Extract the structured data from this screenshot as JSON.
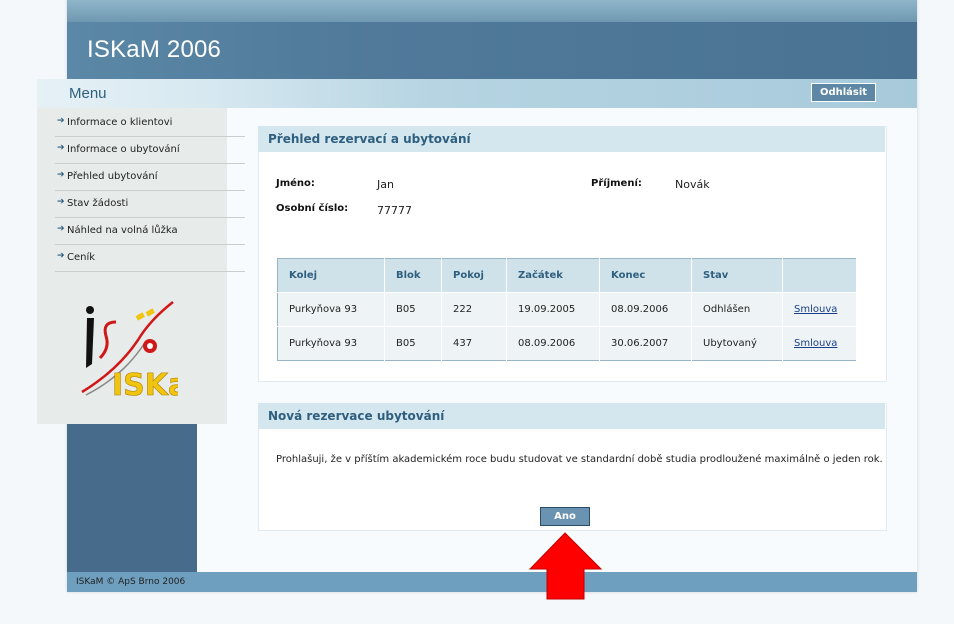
{
  "header": {
    "title": "ISKaM 2006",
    "menu_label": "Menu",
    "logout_label": "Odhlásit"
  },
  "sidebar": {
    "items": [
      {
        "label": "Informace o klientovi"
      },
      {
        "label": "Informace o ubytování"
      },
      {
        "label": "Přehled ubytování"
      },
      {
        "label": "Stav žádosti"
      },
      {
        "label": "Náhled na volná lůžka"
      },
      {
        "label": "Ceník"
      }
    ],
    "logo_text": "ISKaM"
  },
  "overview": {
    "title": "Přehled rezervací a ubytování",
    "name_label": "Jméno:",
    "name_value": "Jan",
    "surname_label": "Příjmení:",
    "surname_value": "Novák",
    "id_label": "Osobní číslo:",
    "id_value": "77777",
    "columns": [
      "Kolej",
      "Blok",
      "Pokoj",
      "Začátek",
      "Konec",
      "Stav",
      ""
    ],
    "rows": [
      {
        "kolej": "Purkyňova 93",
        "blok": "B05",
        "pokoj": "222",
        "zacatek": "19.09.2005",
        "konec": "08.09.2006",
        "stav": "Odhlášen",
        "link": "Smlouva"
      },
      {
        "kolej": "Purkyňova 93",
        "blok": "B05",
        "pokoj": "437",
        "zacatek": "08.09.2006",
        "konec": "30.06.2007",
        "stav": "Ubytovaný",
        "link": "Smlouva"
      }
    ]
  },
  "new_reservation": {
    "title": "Nová rezervace ubytování",
    "declaration": "Prohlašuji, že v příštím akademickém roce budu studovat ve standardní době studia prodloužené maximálně o jeden rok.",
    "yes_label": "Ano"
  },
  "footer": {
    "text": "ISKaM © ApS Brno 2006"
  },
  "colors": {
    "banner": "#4f7898",
    "accent": "#2f5f7f",
    "pointer_arrow": "#ff0000"
  }
}
